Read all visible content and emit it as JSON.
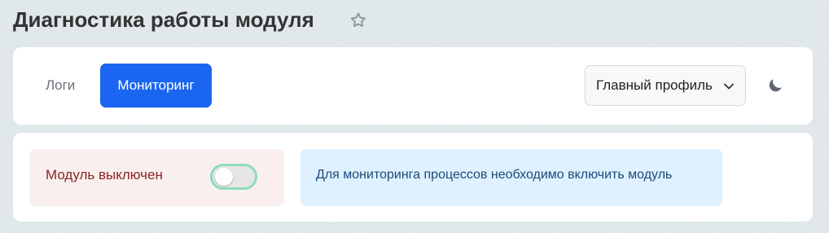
{
  "page": {
    "title": "Диагностика работы модуля",
    "favorite_icon": "star-outline-icon"
  },
  "tabs": [
    {
      "label": "Логи",
      "active": false
    },
    {
      "label": "Мониторинг",
      "active": true
    }
  ],
  "toolbar": {
    "profile_select_value": "Главный профиль",
    "theme_icon": "moon-icon"
  },
  "module": {
    "status_label": "Модуль выключен",
    "enabled": false,
    "info_message": "Для мониторинга процессов необходимо включить модуль"
  },
  "colors": {
    "accent": "#1a66f0",
    "status_error_bg": "#f9efef",
    "status_error_text": "#8c2525",
    "info_bg": "#dff0fe",
    "info_text": "#1c4a7a",
    "toggle_focus_ring": "#8fdcbc"
  }
}
